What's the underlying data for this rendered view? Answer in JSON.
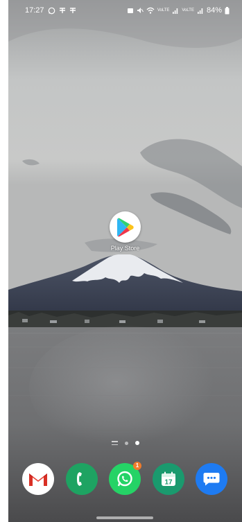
{
  "status_bar": {
    "time": "17:27",
    "left_icons": [
      "whatsapp-status-icon",
      "notification-icon",
      "notification-icon"
    ],
    "right_icons": [
      "alarm-icon",
      "mute-icon",
      "wifi-icon",
      "signal-icon",
      "signal-icon"
    ],
    "network_labels": [
      "VoLTE",
      "VoLTE"
    ],
    "battery": "84%"
  },
  "home": {
    "apps": [
      {
        "label": "Play Store",
        "icon": "play-store-icon"
      }
    ],
    "page_indicator": {
      "pages": 2,
      "active_index": 1
    }
  },
  "dock": {
    "apps": [
      {
        "icon": "gmail-icon",
        "color": "#ffffff"
      },
      {
        "icon": "phone-icon",
        "color": "#1ea362"
      },
      {
        "icon": "whatsapp-icon",
        "color": "#25d366",
        "badge": "1"
      },
      {
        "icon": "calendar-icon",
        "color": "#1a9a6e",
        "text": "17"
      },
      {
        "icon": "messages-icon",
        "color": "#1e7bf2"
      }
    ]
  },
  "colors": {
    "badge": "#f07b2b",
    "sky": "#b9bcbd",
    "lake": "#6e6e70"
  }
}
